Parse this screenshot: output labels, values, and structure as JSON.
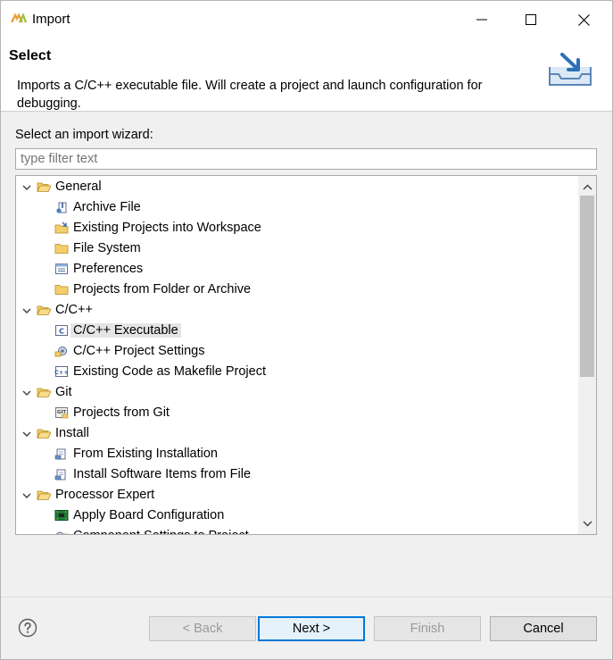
{
  "window": {
    "title": "Import"
  },
  "banner": {
    "title": "Select",
    "description": "Imports a C/C++ executable file. Will create a project and launch configuration for debugging."
  },
  "wizard_label": "Select an import wizard:",
  "filter": {
    "placeholder": "type filter text",
    "value": ""
  },
  "tree": [
    {
      "label": "General",
      "kind": "category",
      "expanded": true,
      "icon": "folder-open-icon"
    },
    {
      "label": "Archive File",
      "kind": "item",
      "icon": "archive-file-icon"
    },
    {
      "label": "Existing Projects into Workspace",
      "kind": "item",
      "icon": "existing-projects-icon"
    },
    {
      "label": "File System",
      "kind": "item",
      "icon": "folder-icon"
    },
    {
      "label": "Preferences",
      "kind": "item",
      "icon": "preferences-icon"
    },
    {
      "label": "Projects from Folder or Archive",
      "kind": "item",
      "icon": "folder-icon"
    },
    {
      "label": "C/C++",
      "kind": "category",
      "expanded": true,
      "icon": "folder-open-icon"
    },
    {
      "label": "C/C++ Executable",
      "kind": "item",
      "icon": "c-executable-icon",
      "selected": true
    },
    {
      "label": "C/C++ Project Settings",
      "kind": "item",
      "icon": "project-settings-icon"
    },
    {
      "label": "Existing Code as Makefile Project",
      "kind": "item",
      "icon": "makefile-project-icon"
    },
    {
      "label": "Git",
      "kind": "category",
      "expanded": true,
      "icon": "folder-open-icon"
    },
    {
      "label": "Projects from Git",
      "kind": "item",
      "icon": "git-icon"
    },
    {
      "label": "Install",
      "kind": "category",
      "expanded": true,
      "icon": "folder-open-icon"
    },
    {
      "label": "From Existing Installation",
      "kind": "item",
      "icon": "install-icon"
    },
    {
      "label": "Install Software Items from File",
      "kind": "item",
      "icon": "install-icon"
    },
    {
      "label": "Processor Expert",
      "kind": "category",
      "expanded": true,
      "icon": "folder-open-icon"
    },
    {
      "label": "Apply Board Configuration",
      "kind": "item",
      "icon": "board-icon"
    },
    {
      "label": "Component Settings to Project",
      "kind": "item",
      "icon": "component-settings-icon"
    }
  ],
  "buttons": {
    "back": "< Back",
    "next": "Next >",
    "finish": "Finish",
    "cancel": "Cancel"
  },
  "colors": {
    "accent": "#0078d7",
    "folder": "#e8b84a",
    "selection": "#e5e5e5"
  }
}
